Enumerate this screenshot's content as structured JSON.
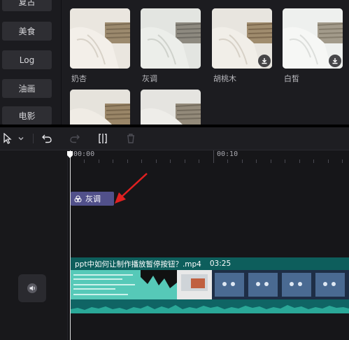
{
  "categories": [
    "复古",
    "美食",
    "Log",
    "油画",
    "电影"
  ],
  "filters": [
    {
      "label": "奶杏",
      "download": false
    },
    {
      "label": "灰调",
      "download": false
    },
    {
      "label": "胡桃木",
      "download": true
    },
    {
      "label": "白皙",
      "download": true
    },
    {
      "label": "",
      "download": false
    },
    {
      "label": "",
      "download": false
    }
  ],
  "timeline": {
    "ruler_labels": [
      "00:00",
      "00:10"
    ],
    "filter_clip": {
      "label": "灰调",
      "color": "#51508a"
    },
    "video_clip": {
      "name": "ppt中如何让制作播放暂停按钮？.mp4",
      "duration": "03:25",
      "color": "#0f6f6a"
    }
  },
  "icons": {
    "select": "cursor-arrow-icon",
    "undo": "undo-icon",
    "redo": "redo-icon",
    "split": "split-icon",
    "delete": "trash-icon",
    "volume": "speaker-icon",
    "download": "download-icon",
    "filter": "filter-icon"
  },
  "colors": {
    "accent_arrow": "#e02020",
    "playhead": "#dcdcdc"
  }
}
